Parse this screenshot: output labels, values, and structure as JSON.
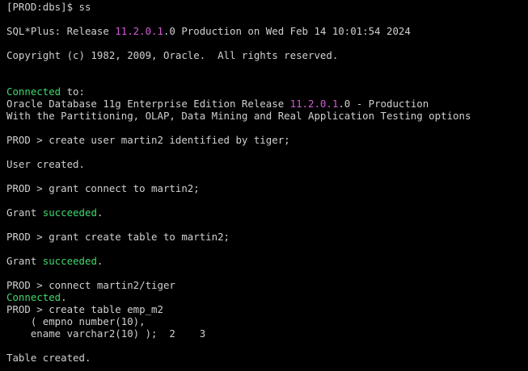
{
  "colors": {
    "background": "#000000",
    "text": "#d0d0d0",
    "highlight_magenta": "#d35bd3",
    "highlight_green": "#3fd86c"
  },
  "terminal": {
    "shell_prompt": "[PROD:dbs]$ ss",
    "banner": {
      "prefix": "SQL*Plus: Release ",
      "version": "11.2.0.1",
      "suffix": ".0 Production on Wed Feb 14 10:01:54 2024"
    },
    "copyright": "Copyright (c) 1982, 2009, Oracle.  All rights reserved.",
    "connected_to": {
      "word": "Connected",
      "rest": " to:"
    },
    "db_line": {
      "prefix": "Oracle Database 11g Enterprise Edition Release ",
      "version": "11.2.0.1",
      "suffix": ".0 - Production"
    },
    "options_line": "With the Partitioning, OLAP, Data Mining and Real Application Testing options",
    "cmd1": "PROD > create user martin2 identified by tiger;",
    "out1": "User created.",
    "cmd2": "PROD > grant connect to martin2;",
    "out2": {
      "prefix": "Grant ",
      "word": "succeeded",
      "suffix": "."
    },
    "cmd3": "PROD > grant create table to martin2;",
    "out3": {
      "prefix": "Grant ",
      "word": "succeeded",
      "suffix": "."
    },
    "cmd4": "PROD > connect martin2/tiger",
    "out4": {
      "word": "Connected",
      "suffix": "."
    },
    "cmd5": "PROD > create table emp_m2",
    "cmd5_line2": "    ( empno number(10),",
    "cmd5_line3": "    ename varchar2(10) );  2    3",
    "out5": "Table created."
  }
}
